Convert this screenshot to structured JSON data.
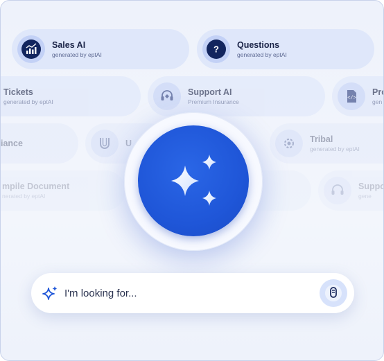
{
  "cards": {
    "sales_ai": {
      "title": "Sales AI",
      "subtitle": "generated by eptAI",
      "icon": "chart-growth-icon"
    },
    "questions": {
      "title": "Questions",
      "subtitle": "generated by eptAI",
      "icon": "question-icon"
    },
    "tickets": {
      "title": "Tickets",
      "subtitle": "generated by eptAI"
    },
    "support_ai": {
      "title": "Support AI",
      "subtitle": "Premium Insurance",
      "icon": "headset-icon"
    },
    "pro": {
      "title": "Pro",
      "subtitle": "gen",
      "icon": "code-document-icon"
    },
    "compliance": {
      "title": "iance",
      "subtitle": ""
    },
    "unitedhealth": {
      "title": "U",
      "subtitle": "",
      "icon": "unitedhealth-logo-icon"
    },
    "tribal": {
      "title": "Tribal",
      "subtitle": "generated by eptAI",
      "icon": "gear-icon"
    },
    "compile_document": {
      "title": "mpile Document",
      "subtitle": "nerated by eptAI"
    },
    "support_faded": {
      "title": "Suppo",
      "subtitle": "gene",
      "icon": "headset-icon"
    }
  },
  "search": {
    "placeholder": "I'm looking for...",
    "icon": "sparkle-icon",
    "action_icon": "microphone-icon"
  },
  "center_orb": {
    "icon": "sparkles-icon"
  },
  "colors": {
    "accent": "#1f56d8",
    "card_bg": "#dfe7fa",
    "page_bg": "#eef2fb"
  }
}
